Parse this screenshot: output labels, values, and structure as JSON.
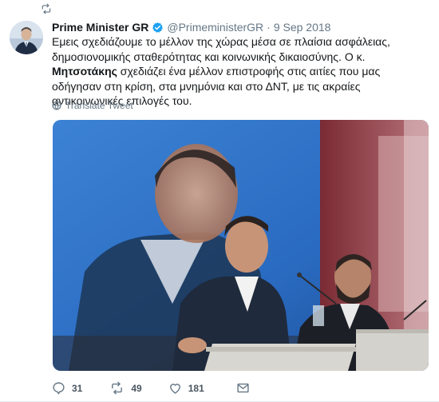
{
  "tweet": {
    "display_name": "Prime Minister GR",
    "handle": "@PrimeministerGR",
    "separator": "·",
    "date": "9 Sep 2018",
    "text_part1": "Εμεις σχεδιάζουμε το μέλλον της χώρας μέσα σε πλαίσια ασφάλειας, δημοσιονομικής σταθερότητας και κοινωνικής δικαιοσύνης. Ο κ. ",
    "text_bold": "Μητσοτάκης",
    "text_part2": " σχεδιάζει ένα μέλλον επιστροφής στις αιτίες που μας οδήγησαν στη κρίση, στα μνημόνια και στο ΔΝΤ, με τις ακραίες αντικοινωνικές επιλογές του.",
    "translate_label": "Translate Tweet"
  },
  "actions": {
    "replies": "31",
    "retweets": "49",
    "likes": "181"
  },
  "colors": {
    "verified": "#1da1f2",
    "secondary_text": "#657786",
    "retweet_icon": "#657786"
  },
  "icons": {
    "retweet_indicator": "retweet-icon",
    "verified": "verified-badge-icon",
    "translate": "globe-icon",
    "reply": "reply-icon",
    "retweet": "retweet-icon",
    "like": "heart-icon",
    "dm": "envelope-icon"
  }
}
